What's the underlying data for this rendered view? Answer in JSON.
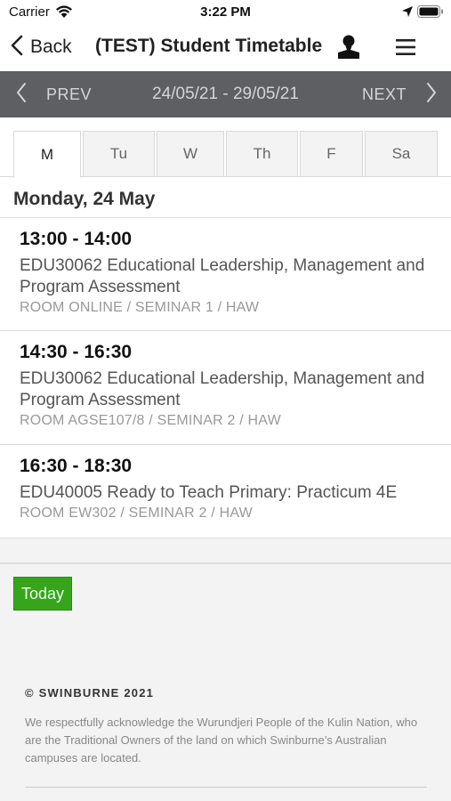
{
  "status_bar": {
    "carrier": "Carrier",
    "time": "3:22 PM"
  },
  "nav": {
    "back_label": "Back",
    "title": "(TEST) Student Timetable"
  },
  "date_nav": {
    "prev_label": "PREV",
    "range": "24/05/21 - 29/05/21",
    "next_label": "NEXT"
  },
  "tabs": [
    {
      "label": "M",
      "active": true
    },
    {
      "label": "Tu",
      "active": false
    },
    {
      "label": "W",
      "active": false
    },
    {
      "label": "Th",
      "active": false
    },
    {
      "label": "F",
      "active": false
    },
    {
      "label": "Sa",
      "active": false
    }
  ],
  "day_heading": "Monday, 24 May",
  "classes": [
    {
      "time": "13:00 - 14:00",
      "subject": "EDU30062 Educational Leadership, Management and Program Assessment",
      "room": "ROOM ONLINE / SEMINAR 1 / HAW"
    },
    {
      "time": "14:30 - 16:30",
      "subject": "EDU30062 Educational Leadership, Management and Program Assessment",
      "room": "ROOM AGSE107/8 / SEMINAR 2 / HAW"
    },
    {
      "time": "16:30 - 18:30",
      "subject": "EDU40005 Ready to Teach Primary: Practicum 4E",
      "room": "ROOM EW302 / SEMINAR 2 / HAW"
    }
  ],
  "today_label": "Today",
  "footer": {
    "copyright": "© SWINBURNE 2021",
    "acknowledgement": "We respectfully acknowledge the Wurundjeri People of the Kulin Nation, who are the Traditional Owners of the land on which Swinburne’s Australian campuses are located."
  },
  "colors": {
    "date_bar": "#5d5f63",
    "today_button": "#36a51c"
  }
}
